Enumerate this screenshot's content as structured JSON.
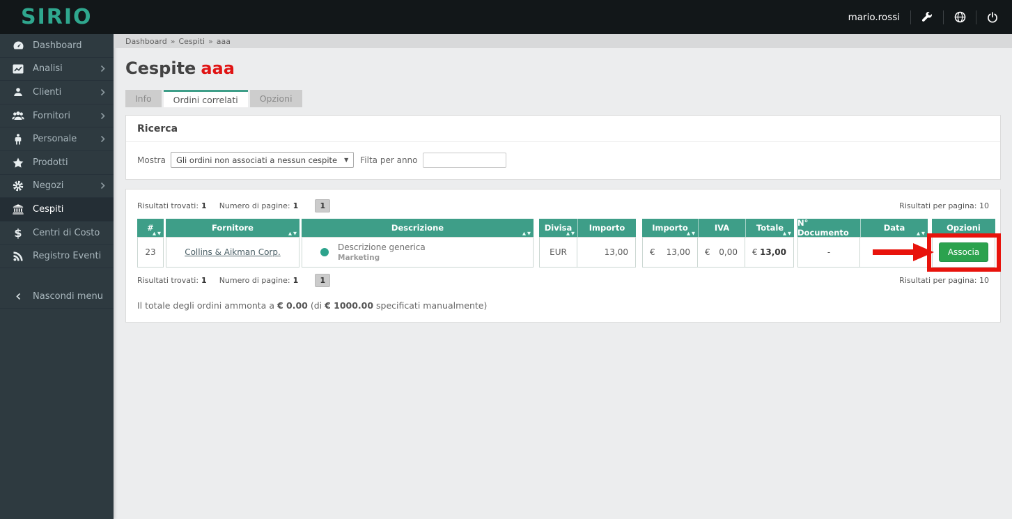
{
  "topbar": {
    "logo": "SIRIO",
    "username": "mario.rossi"
  },
  "sidebar": {
    "items": [
      {
        "label": "Dashboard",
        "icon": "dashboard-icon",
        "has_submenu": false,
        "active": false
      },
      {
        "label": "Analisi",
        "icon": "chart-icon",
        "has_submenu": true,
        "active": false
      },
      {
        "label": "Clienti",
        "icon": "user-icon",
        "has_submenu": true,
        "active": false
      },
      {
        "label": "Fornitori",
        "icon": "users-icon",
        "has_submenu": true,
        "active": false
      },
      {
        "label": "Personale",
        "icon": "person-icon",
        "has_submenu": true,
        "active": false
      },
      {
        "label": "Prodotti",
        "icon": "star-icon",
        "has_submenu": false,
        "active": false
      },
      {
        "label": "Negozi",
        "icon": "gear-icon",
        "has_submenu": true,
        "active": false
      },
      {
        "label": "Cespiti",
        "icon": "bank-icon",
        "has_submenu": false,
        "active": true
      },
      {
        "label": "Centri di Costo",
        "icon": "dollar-icon",
        "has_submenu": false,
        "active": false
      },
      {
        "label": "Registro Eventi",
        "icon": "rss-icon",
        "has_submenu": false,
        "active": false
      }
    ],
    "collapse_label": "Nascondi menu"
  },
  "breadcrumb": {
    "separator": "»",
    "items": [
      "Dashboard",
      "Cespiti",
      "aaa"
    ]
  },
  "page": {
    "title_prefix": "Cespite",
    "title_highlight": "aaa"
  },
  "tabs": [
    {
      "label": "Info",
      "active": false
    },
    {
      "label": "Ordini correlati",
      "active": true
    },
    {
      "label": "Opzioni",
      "active": false
    }
  ],
  "search": {
    "heading": "Ricerca",
    "show_label": "Mostra",
    "select_value": "Gli ordini non associati a nessun cespite",
    "year_filter_label": "Filta per anno",
    "year_filter_value": ""
  },
  "results": {
    "found_label": "Risultati trovati:",
    "found_value": "1",
    "pages_label": "Numero di pagine:",
    "pages_value": "1",
    "page_button": "1",
    "per_page_label": "Risultati per pagina: 10",
    "table": {
      "columns": [
        "#",
        "Fornitore",
        "Descrizione",
        "Divisa",
        "Importo",
        "Importo",
        "IVA",
        "Totale",
        "N° Documento",
        "Data",
        "Opzioni"
      ],
      "sortable_columns": [
        "#",
        "Fornitore",
        "Descrizione",
        "Divisa",
        "Importo",
        "Totale",
        "Data"
      ],
      "row": {
        "number": "23",
        "fornitore": "Collins & Aikman Corp.",
        "descrizione": "Descrizione generica",
        "categoria": "Marketing",
        "divisa": "EUR",
        "importo": "13,00",
        "currency": "€",
        "importo_eur": "13,00",
        "iva": "0,00",
        "totale": "13,00",
        "n_documento": "-",
        "data": "",
        "action_label": "Associa"
      }
    },
    "total_line": {
      "part1": "Il totale degli ordini ammonta a ",
      "amount": "€ 0.00",
      "part2": " (di ",
      "manual_amount": "€ 1000.00",
      "part3": " specificati manualmente)"
    }
  },
  "icons": {
    "sort_asc": "▲",
    "sort_desc": "▼",
    "select_caret": "▼",
    "dollar": "$"
  },
  "colors": {
    "teal_header": "#3E9E88",
    "topbar_bg": "#121719",
    "sidebar_bg": "#2E3A40",
    "green_button": "#2BA24E",
    "highlight_red": "#E8130C",
    "title_red": "#E01414"
  }
}
